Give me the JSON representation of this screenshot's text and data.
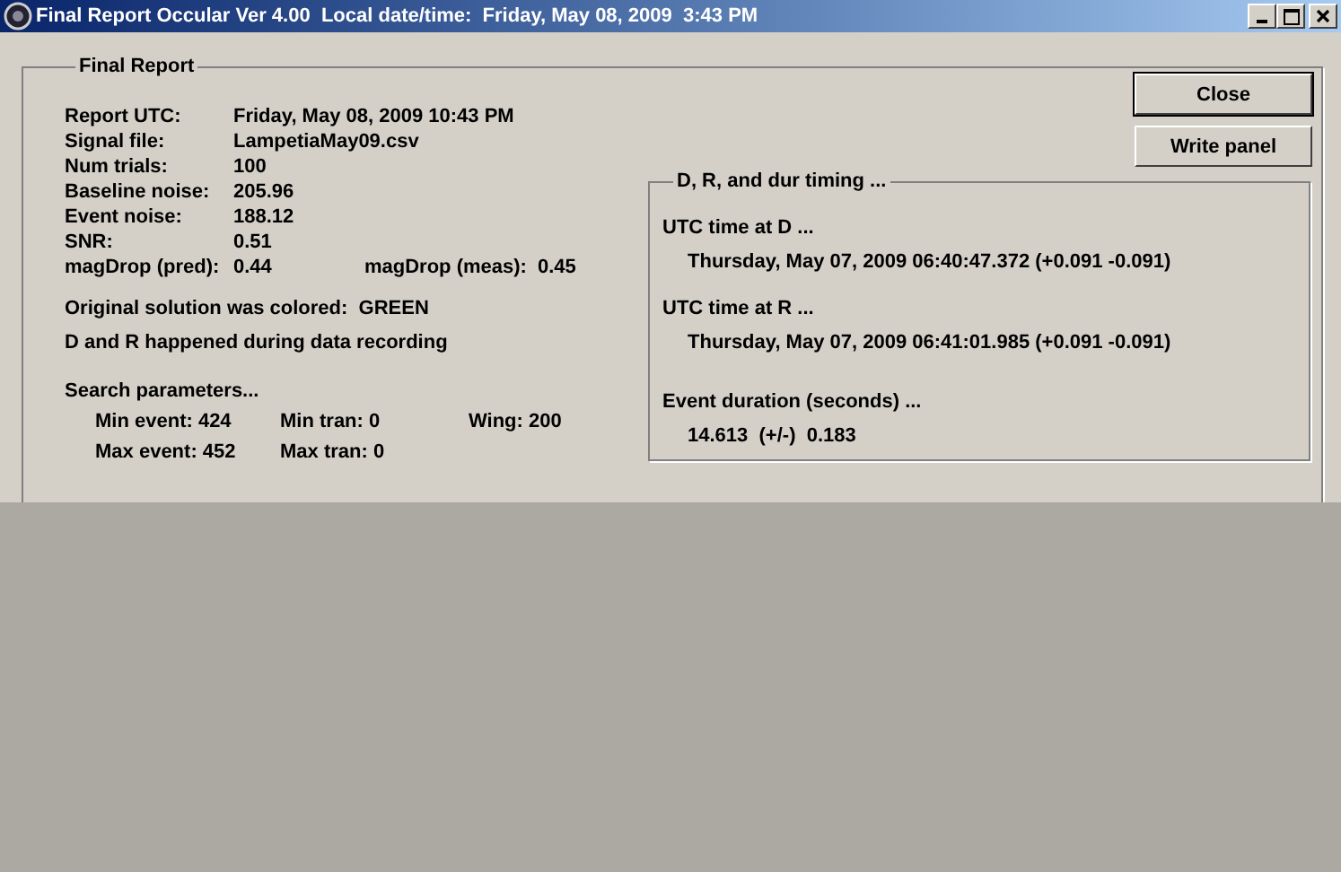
{
  "window": {
    "title": "Final Report Occular Ver 4.00  Local date/time:  Friday, May 08, 2009  3:43 PM"
  },
  "report": {
    "title": "Final Report",
    "fields": [
      {
        "label": "Report UTC:",
        "value": "Friday, May 08, 2009 10:43 PM"
      },
      {
        "label": "Signal file:",
        "value": "LampetiaMay09.csv"
      },
      {
        "label": "Num trials:",
        "value": "100"
      },
      {
        "label": "Baseline noise:",
        "value": "205.96"
      },
      {
        "label": "Event noise:",
        "value": "188.12"
      },
      {
        "label": "SNR:",
        "value": "0.51"
      }
    ],
    "magdrop": [
      {
        "label": "magDrop (pred):",
        "value": "0.44"
      },
      {
        "label": "magDrop (meas):",
        "value": "0.45"
      }
    ],
    "solution_color": "Original solution was colored:  GREEN",
    "recording_note": "D and R happened during data recording",
    "search": {
      "title": "Search parameters...",
      "rows": [
        [
          {
            "label": "Min event:",
            "value": "424"
          },
          {
            "label": "Min tran:",
            "value": "0"
          },
          {
            "label": "Wing:",
            "value": "200"
          }
        ],
        [
          {
            "label": "Max event:",
            "value": "452"
          },
          {
            "label": "Max tran:",
            "value": "0"
          }
        ]
      ]
    }
  },
  "buttons": [
    "Close",
    "Write panel"
  ],
  "timing": {
    "title": "D, R, and dur timing ...",
    "sections": [
      {
        "heading": "UTC time at D ...",
        "value": "Thursday, May 07, 2009 06:40:47.372 (+0.091 -0.091)"
      },
      {
        "heading": "UTC time at R ...",
        "value": "Thursday, May 07, 2009 06:41:01.985 (+0.091 -0.091)"
      },
      {
        "heading": "Event duration (seconds) ...",
        "value": "14.613  (+/-)  0.183"
      }
    ]
  }
}
